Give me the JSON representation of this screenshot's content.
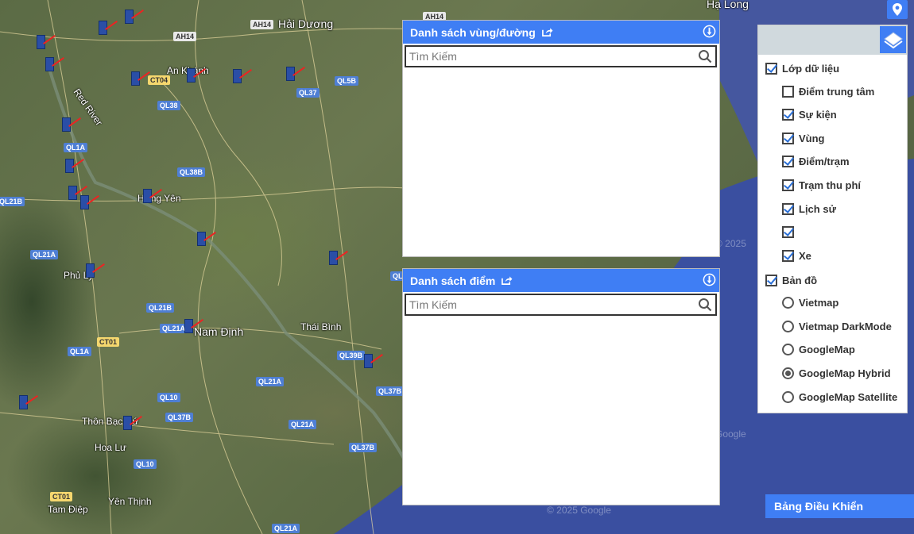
{
  "map": {
    "places": [
      {
        "name": "Hải Dương",
        "big": true
      },
      {
        "name": "Hạ Long",
        "big": true
      },
      {
        "name": "An Khánh",
        "big": false
      },
      {
        "name": "Hưng Yên",
        "big": false
      },
      {
        "name": "Phủ Lý",
        "big": false
      },
      {
        "name": "Nam Định",
        "big": true
      },
      {
        "name": "Thái Bình",
        "big": false
      },
      {
        "name": "Thôn Bạc Cứ",
        "big": false
      },
      {
        "name": "Hoa Lư",
        "big": false
      },
      {
        "name": "Yên Thịnh",
        "big": false
      },
      {
        "name": "Tam Điệp",
        "big": false
      },
      {
        "name": "Red River",
        "big": false
      }
    ],
    "roads": [
      {
        "label": "AH14"
      },
      {
        "label": "AH14"
      },
      {
        "label": "AH14"
      },
      {
        "label": "CT04"
      },
      {
        "label": "QL38"
      },
      {
        "label": "QL37"
      },
      {
        "label": "QL5B"
      },
      {
        "label": "QL1A"
      },
      {
        "label": "QL38B"
      },
      {
        "label": "QL21B"
      },
      {
        "label": "QL21A"
      },
      {
        "label": "QL21B"
      },
      {
        "label": "QL21A"
      },
      {
        "label": "CT01"
      },
      {
        "label": "QL1A"
      },
      {
        "label": "QL39B"
      },
      {
        "label": "QL21A"
      },
      {
        "label": "QL37B"
      },
      {
        "label": "QL10"
      },
      {
        "label": "QL37B"
      },
      {
        "label": "QL21A"
      },
      {
        "label": "QL37B"
      },
      {
        "label": "QL10"
      },
      {
        "label": "CT01"
      },
      {
        "label": "QL21A"
      },
      {
        "label": "QL"
      }
    ],
    "copyright": [
      "© 2025",
      "Google",
      "© 2025 Google"
    ]
  },
  "region_panel": {
    "title": "Danh sách vùng/đường",
    "search_placeholder": "Tìm Kiếm"
  },
  "point_panel": {
    "title": "Danh sách điểm",
    "search_placeholder": "Tìm Kiếm"
  },
  "layers": {
    "data_layer": {
      "label": "Lớp dữ liệu",
      "checked": true
    },
    "items": [
      {
        "label": "Điểm trung tâm",
        "checked": false
      },
      {
        "label": "Sự kiện",
        "checked": true
      },
      {
        "label": "Vùng",
        "checked": true
      },
      {
        "label": "Điểm/trạm",
        "checked": true
      },
      {
        "label": "Trạm thu phí",
        "checked": true
      },
      {
        "label": "Lịch sử",
        "checked": true
      },
      {
        "label": "",
        "checked": true
      },
      {
        "label": "Xe",
        "checked": true
      }
    ],
    "base_map": {
      "label": "Bản đồ",
      "checked": true
    },
    "maps": [
      {
        "label": "Vietmap",
        "selected": false
      },
      {
        "label": "Vietmap DarkMode",
        "selected": false
      },
      {
        "label": "GoogleMap",
        "selected": false
      },
      {
        "label": "GoogleMap Hybrid",
        "selected": true
      },
      {
        "label": "GoogleMap Satellite",
        "selected": false
      }
    ]
  },
  "control_panel": {
    "label": "Bảng Điều Khiển"
  },
  "colors": {
    "accent": "#3f7ef4",
    "sea": "#3a4fa0"
  }
}
